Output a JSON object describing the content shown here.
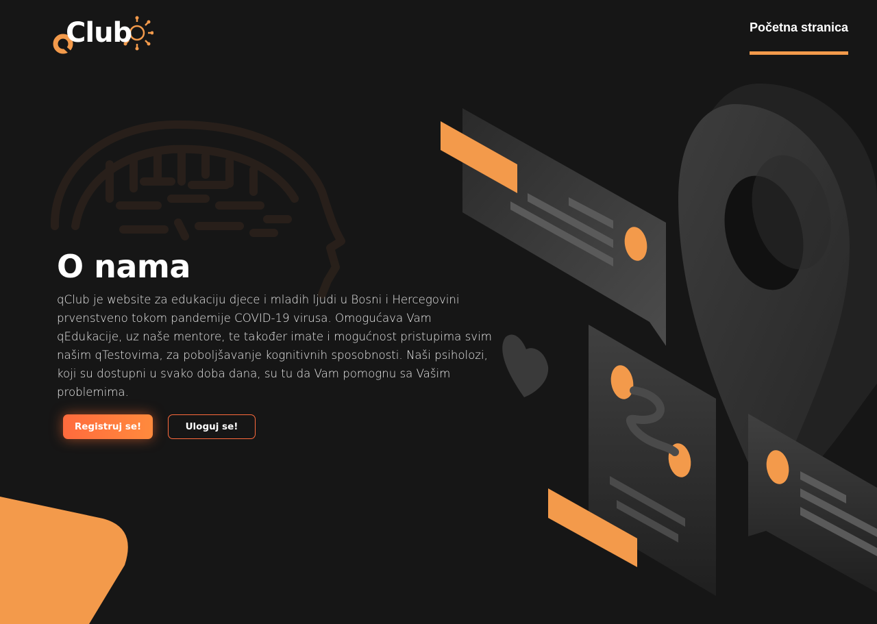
{
  "header": {
    "logo_text": "Club",
    "nav_link": "Početna stranica"
  },
  "hero": {
    "title": "O nama",
    "description": "qClub je website za edukaciju djece i mladih ljudi u Bosni i Hercegovini prvenstveno tokom pandemije COVID-19 virusa. Omogućava Vam qEdukacije, uz naše mentore, te također imate i mogućnost pristupima svim našim qTestovima, za poboljšavanje kognitivnih sposobnosti. Naši psiholozi, koji su dostupni u svako doba dana, su tu da Vam pomognu sa Vašim problemima.",
    "register_button": "Registruj se!",
    "login_button": "Uloguj se!"
  },
  "colors": {
    "background": "#161616",
    "accent": "#f39a4b",
    "button_gradient_start": "#ff6b3d",
    "button_gradient_end": "#ff8a3d"
  },
  "icons": {
    "logo": "qclub-logo-icon",
    "brain": "brain-icon",
    "heart": "heart-icon",
    "location_pin": "location-pin-icon"
  }
}
